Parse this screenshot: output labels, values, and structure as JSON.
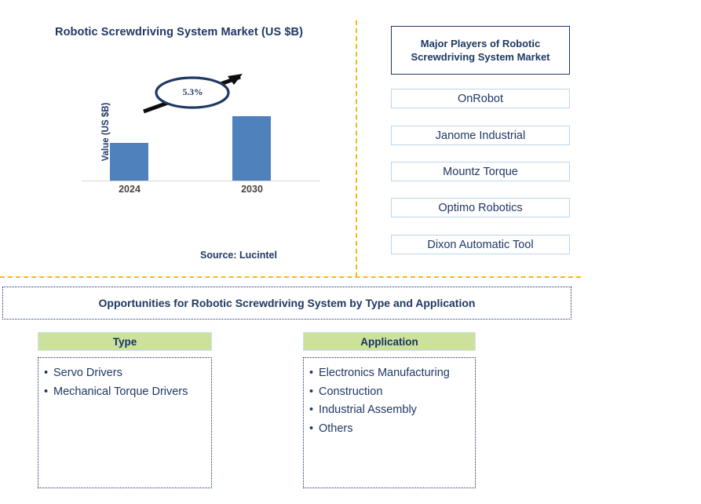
{
  "chart": {
    "title": "Robotic Screwdriving System Market (US $B)",
    "y_axis_label": "Value (US $B)",
    "cagr_label": "5.3%",
    "source": "Source: Lucintel"
  },
  "chart_data": {
    "type": "bar",
    "title": "Robotic Screwdriving System Market (US $B)",
    "categories": [
      "2024",
      "2030"
    ],
    "values": [
      1.0,
      1.36
    ],
    "xlabel": "",
    "ylabel": "Value (US $B)",
    "ylim": [
      0,
      1.6
    ],
    "grid": false,
    "legend": false,
    "bar_color": "#4F81BD",
    "annotations": [
      {
        "text": "5.3%",
        "type": "cagr-callout",
        "from": "2024",
        "to": "2030",
        "shape": "ellipse-with-arrow"
      }
    ],
    "source": "Source: Lucintel"
  },
  "players": {
    "header": "Major Players of Robotic Screwdriving System Market",
    "items": [
      {
        "name": "OnRobot"
      },
      {
        "name": "Janome Industrial"
      },
      {
        "name": "Mountz Torque"
      },
      {
        "name": "Optimo Robotics"
      },
      {
        "name": "Dixon Automatic Tool"
      }
    ]
  },
  "opportunities": {
    "banner": "Opportunities for Robotic Screwdriving System by Type and Application",
    "columns": [
      {
        "header": "Type",
        "items": [
          "Servo Drivers",
          "Mechanical Torque Drivers"
        ]
      },
      {
        "header": "Application",
        "items": [
          "Electronics Manufacturing",
          "Construction",
          "Industrial Assembly",
          "Others"
        ]
      }
    ]
  },
  "colors": {
    "navy": "#1F3864",
    "bar_blue": "#4F81BD",
    "divider_gold": "#F9B618",
    "header_green": "#CCE29C",
    "player_border": "#BBD6EC"
  }
}
